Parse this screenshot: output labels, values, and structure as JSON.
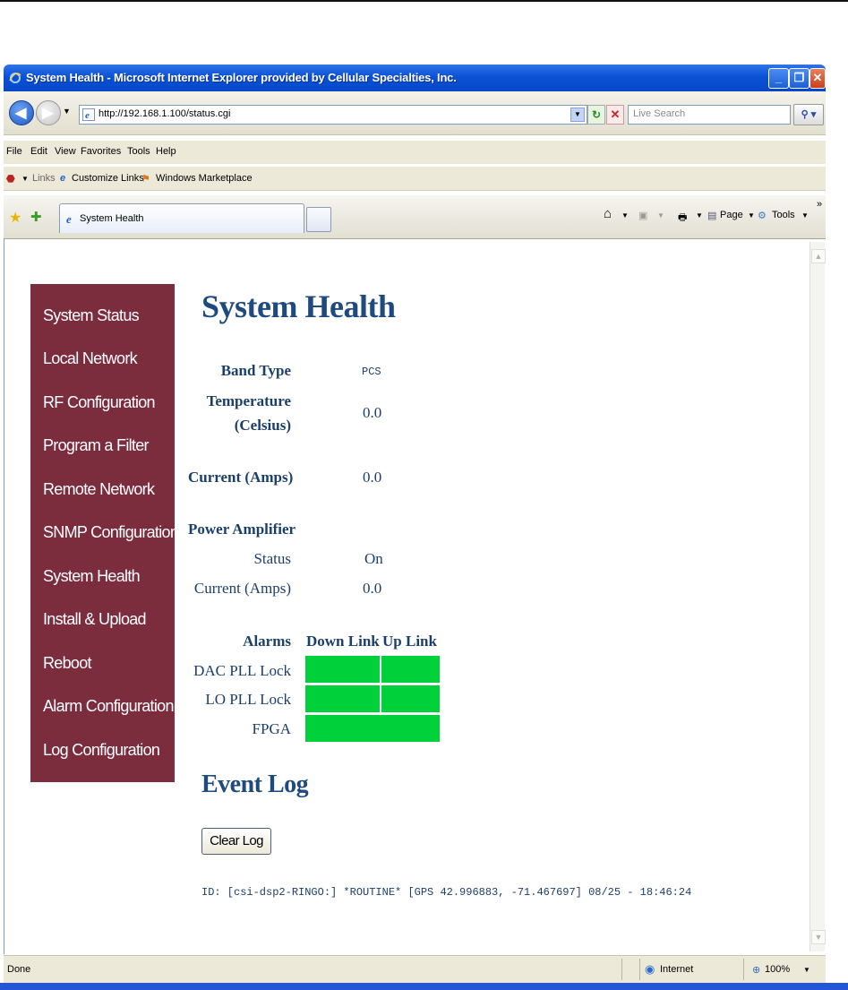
{
  "window": {
    "title": "System Health - Microsoft Internet Explorer provided by Cellular Specialties, Inc."
  },
  "address_bar": {
    "url": "http://192.168.1.100/status.cgi",
    "search_placeholder": "Live Search"
  },
  "menu": [
    "File",
    "Edit",
    "View",
    "Favorites",
    "Tools",
    "Help"
  ],
  "links_bar": {
    "links_label": "Links",
    "items": [
      "Customize Links",
      "Windows Marketplace"
    ]
  },
  "tab": {
    "title": "System Health"
  },
  "command_bar": {
    "page_label": "Page",
    "tools_label": "Tools"
  },
  "sidebar": {
    "items": [
      "System Status",
      "Local Network",
      "RF Configuration",
      "Program a Filter",
      "Remote Network",
      "SNMP Configuration",
      "System Health",
      "Install & Upload",
      "Reboot",
      "Alarm Configuration",
      "Log Configuration"
    ],
    "bg_color": "#7b2d3d"
  },
  "page": {
    "heading": "System Health",
    "band_type_label": "Band Type",
    "band_type_value": "PCS",
    "temperature_label_line1": "Temperature",
    "temperature_label_line2": "(Celsius)",
    "temperature_value": "0.0",
    "current_label": "Current (Amps)",
    "current_value": "0.0",
    "power_amplifier_label": "Power Amplifier",
    "pa_status_label": "Status",
    "pa_status_value": "On",
    "pa_current_label": "Current (Amps)",
    "pa_current_value": "0.0",
    "alarms": {
      "header": "Alarms",
      "col_down": "Down Link",
      "col_up": "Up Link",
      "rows": [
        "DAC PLL Lock",
        "LO PLL Lock",
        "FPGA"
      ],
      "ok_color": "#00d13a"
    },
    "event_log_heading": "Event Log",
    "clear_log_button": "Clear Log",
    "log_entry": "ID: [csi-dsp2-RINGO:] *ROUTINE* [GPS 42.996883, -71.467697] 08/25 - 18:46:24"
  },
  "status_bar": {
    "status": "Done",
    "zone": "Internet",
    "zoom": "100%"
  }
}
